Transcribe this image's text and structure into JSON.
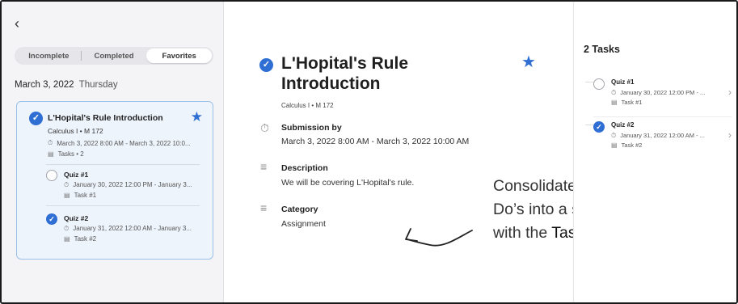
{
  "left": {
    "back_icon": "chevron-left-icon",
    "tabs": [
      {
        "label": "Incomplete",
        "active": false
      },
      {
        "label": "Completed",
        "active": false
      },
      {
        "label": "Favorites",
        "active": true
      }
    ],
    "date": "March 3, 2022",
    "weekday": "Thursday",
    "card": {
      "title": "L'Hopital's Rule Introduction",
      "course": "Calculus I • M 172",
      "time": "March 3, 2022 8:00 AM - March 3, 2022 10:0...",
      "tasks_count": "Tasks • 2",
      "subtasks": [
        {
          "title": "Quiz #1",
          "time": "January 30, 2022 12:00 PM - January 3...",
          "task": "Task #1",
          "completed": false
        },
        {
          "title": "Quiz #2",
          "time": "January 31, 2022 12:00 AM - January 3...",
          "task": "Task #2",
          "completed": true
        }
      ]
    }
  },
  "detail": {
    "title": "L'Hopital's Rule Introduction",
    "course": "Calculus I • M 172",
    "submission_label": "Submission by",
    "submission_value": "March 3, 2022 8:00 AM - March 3, 2022 10:00 AM",
    "description_label": "Description",
    "description_value": "We will be covering L'Hopital's rule.",
    "category_label": "Category",
    "category_value": "Assignment"
  },
  "annotation": {
    "line1": "Consolidate Student To",
    "line2": "Do’s into a single view",
    "line3_prefix": "with the ",
    "line3_bold": "Task Board"
  },
  "tasks_panel": {
    "heading": "2 Tasks",
    "items": [
      {
        "title": "Quiz #1",
        "time": "January 30, 2022 12:00 PM - ...",
        "task": "Task #1",
        "completed": false
      },
      {
        "title": "Quiz #2",
        "time": "January 31, 2022 12:00 AM - ...",
        "task": "Task #2",
        "completed": true
      }
    ]
  },
  "colors": {
    "accent": "#2f6fd3",
    "card_bg": "#eef4fc",
    "card_border": "#9cc0e8"
  }
}
